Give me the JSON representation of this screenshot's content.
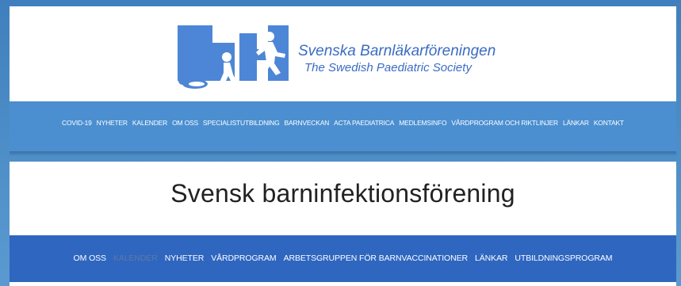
{
  "header": {
    "org_name_sv": "Svenska Barnläkarföreningen",
    "org_name_en": "The Swedish Paediatric Society",
    "logo_color": "#3a6cc3",
    "logo_icon": "children-running-logo"
  },
  "main_nav": {
    "items": [
      {
        "label": "COVID-19"
      },
      {
        "label": "NYHETER"
      },
      {
        "label": "KALENDER"
      },
      {
        "label": "OM OSS"
      },
      {
        "label": "SPECIALISTUTBILDNING"
      },
      {
        "label": "BARNVECKAN"
      },
      {
        "label": "ACTA PAEDIATRICA"
      },
      {
        "label": "MEDLEMSINFO"
      },
      {
        "label": "VÅRDPROGRAM OCH RIKTLINJER"
      },
      {
        "label": "LÄNKAR"
      },
      {
        "label": "KONTAKT"
      }
    ],
    "bg_color": "#4b8fd0"
  },
  "section": {
    "title": "Svensk barninfektionsförening"
  },
  "sub_nav": {
    "items": [
      {
        "label": "OM OSS"
      },
      {
        "label": "KALENDER",
        "active": true
      },
      {
        "label": "NYHETER"
      },
      {
        "label": "VÅRDPROGRAM"
      },
      {
        "label": "ARBETSGRUPPEN FÖR BARNVACCINATIONER"
      },
      {
        "label": "LÄNKAR"
      },
      {
        "label": "UTBILDNINGSPROGRAM"
      }
    ],
    "bg_color": "#2f66bf"
  }
}
